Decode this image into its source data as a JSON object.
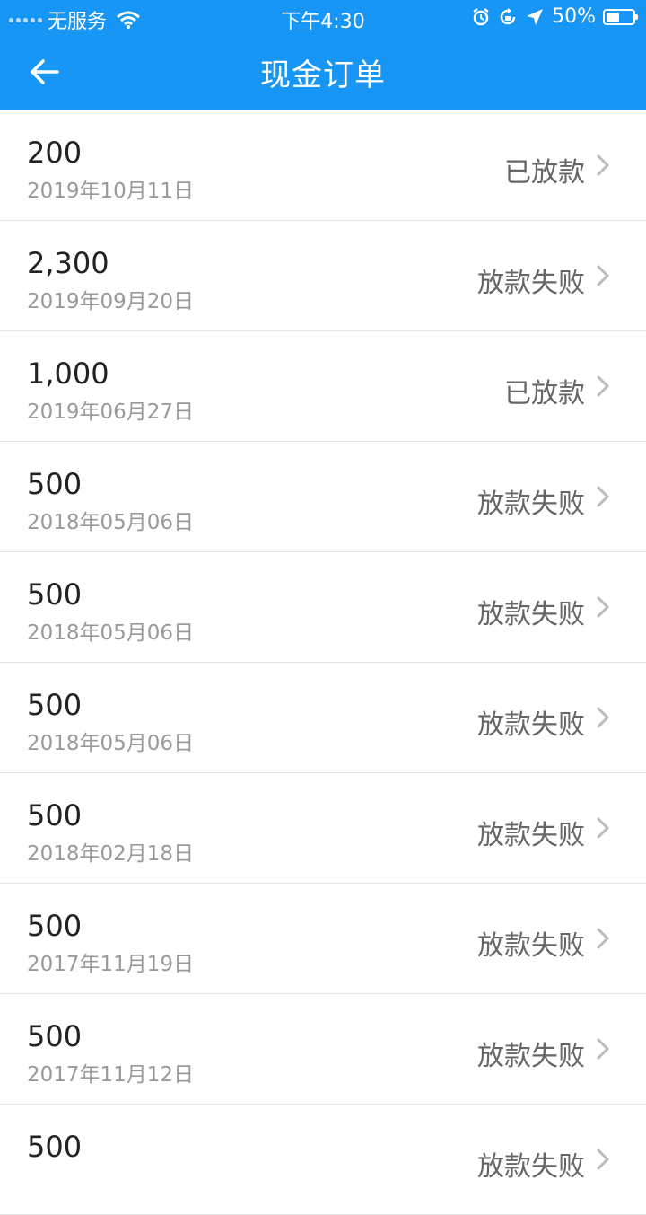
{
  "status_bar": {
    "carrier": "无服务",
    "time": "下午4:30",
    "battery": "50%",
    "battery_level": 0.5
  },
  "nav": {
    "title": "现金订单",
    "back_icon": "arrow-left-icon"
  },
  "colors": {
    "header": "#1796f5",
    "text_primary": "#222222",
    "text_secondary": "#9a9a9a",
    "status_text": "#666666"
  },
  "orders": [
    {
      "amount": "200",
      "date": "2019年10月11日",
      "status": "已放款"
    },
    {
      "amount": "2,300",
      "date": "2019年09月20日",
      "status": "放款失败"
    },
    {
      "amount": "1,000",
      "date": "2019年06月27日",
      "status": "已放款"
    },
    {
      "amount": "500",
      "date": "2018年05月06日",
      "status": "放款失败"
    },
    {
      "amount": "500",
      "date": "2018年05月06日",
      "status": "放款失败"
    },
    {
      "amount": "500",
      "date": "2018年05月06日",
      "status": "放款失败"
    },
    {
      "amount": "500",
      "date": "2018年02月18日",
      "status": "放款失败"
    },
    {
      "amount": "500",
      "date": "2017年11月19日",
      "status": "放款失败"
    },
    {
      "amount": "500",
      "date": "2017年11月12日",
      "status": "放款失败"
    },
    {
      "amount": "500",
      "date": "",
      "status": "放款失败"
    }
  ]
}
